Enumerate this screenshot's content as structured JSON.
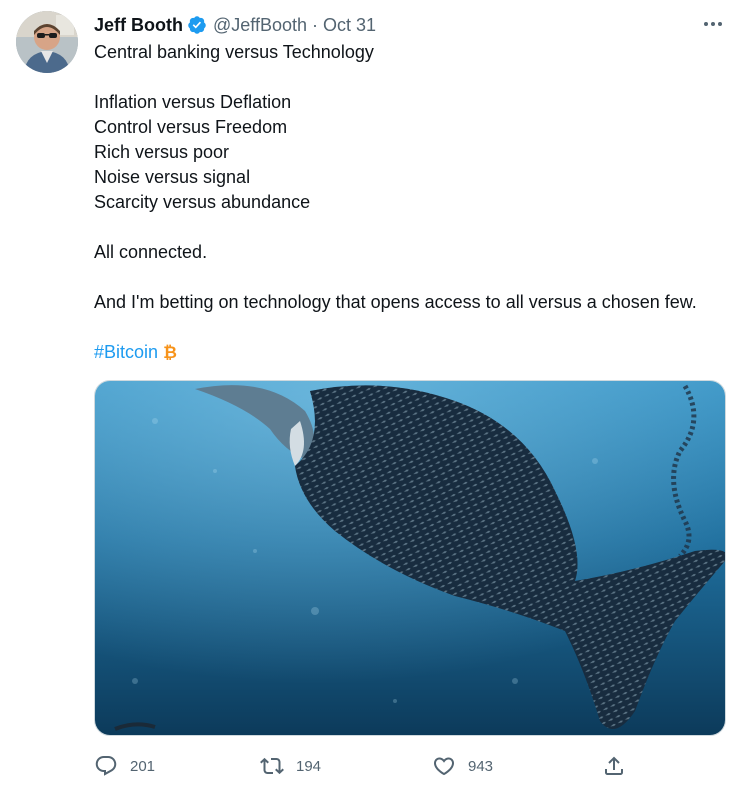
{
  "tweet": {
    "author": {
      "name": "Jeff Booth",
      "handle": "@JeffBooth",
      "separator": "·",
      "date": "Oct 31",
      "verified": true
    },
    "text_lines": [
      "Central banking versus Technology",
      "",
      "Inflation versus Deflation",
      "Control versus Freedom",
      "Rich versus poor",
      "Noise versus signal",
      "Scarcity versus abundance",
      "",
      "All connected.",
      "",
      "And I'm betting on technology that opens access to all versus a chosen few.",
      ""
    ],
    "hashtag": "#Bitcoin",
    "hashtag_emoji": "bitcoin-icon",
    "media": {
      "kind": "photo",
      "alt": "underwater image of a huge whale shape formed by a school of fish swallowing a whale"
    },
    "actions": {
      "replies": "201",
      "retweets": "194",
      "likes": "943",
      "icons": [
        "reply-icon",
        "retweet-icon",
        "like-icon",
        "share-icon"
      ]
    }
  },
  "colors": {
    "text": "#0f1419",
    "secondary": "#536471",
    "link": "#1d9bf0",
    "verified": "#1d9bf0",
    "bitcoin": "#f7931a",
    "border": "#cfd9de"
  }
}
